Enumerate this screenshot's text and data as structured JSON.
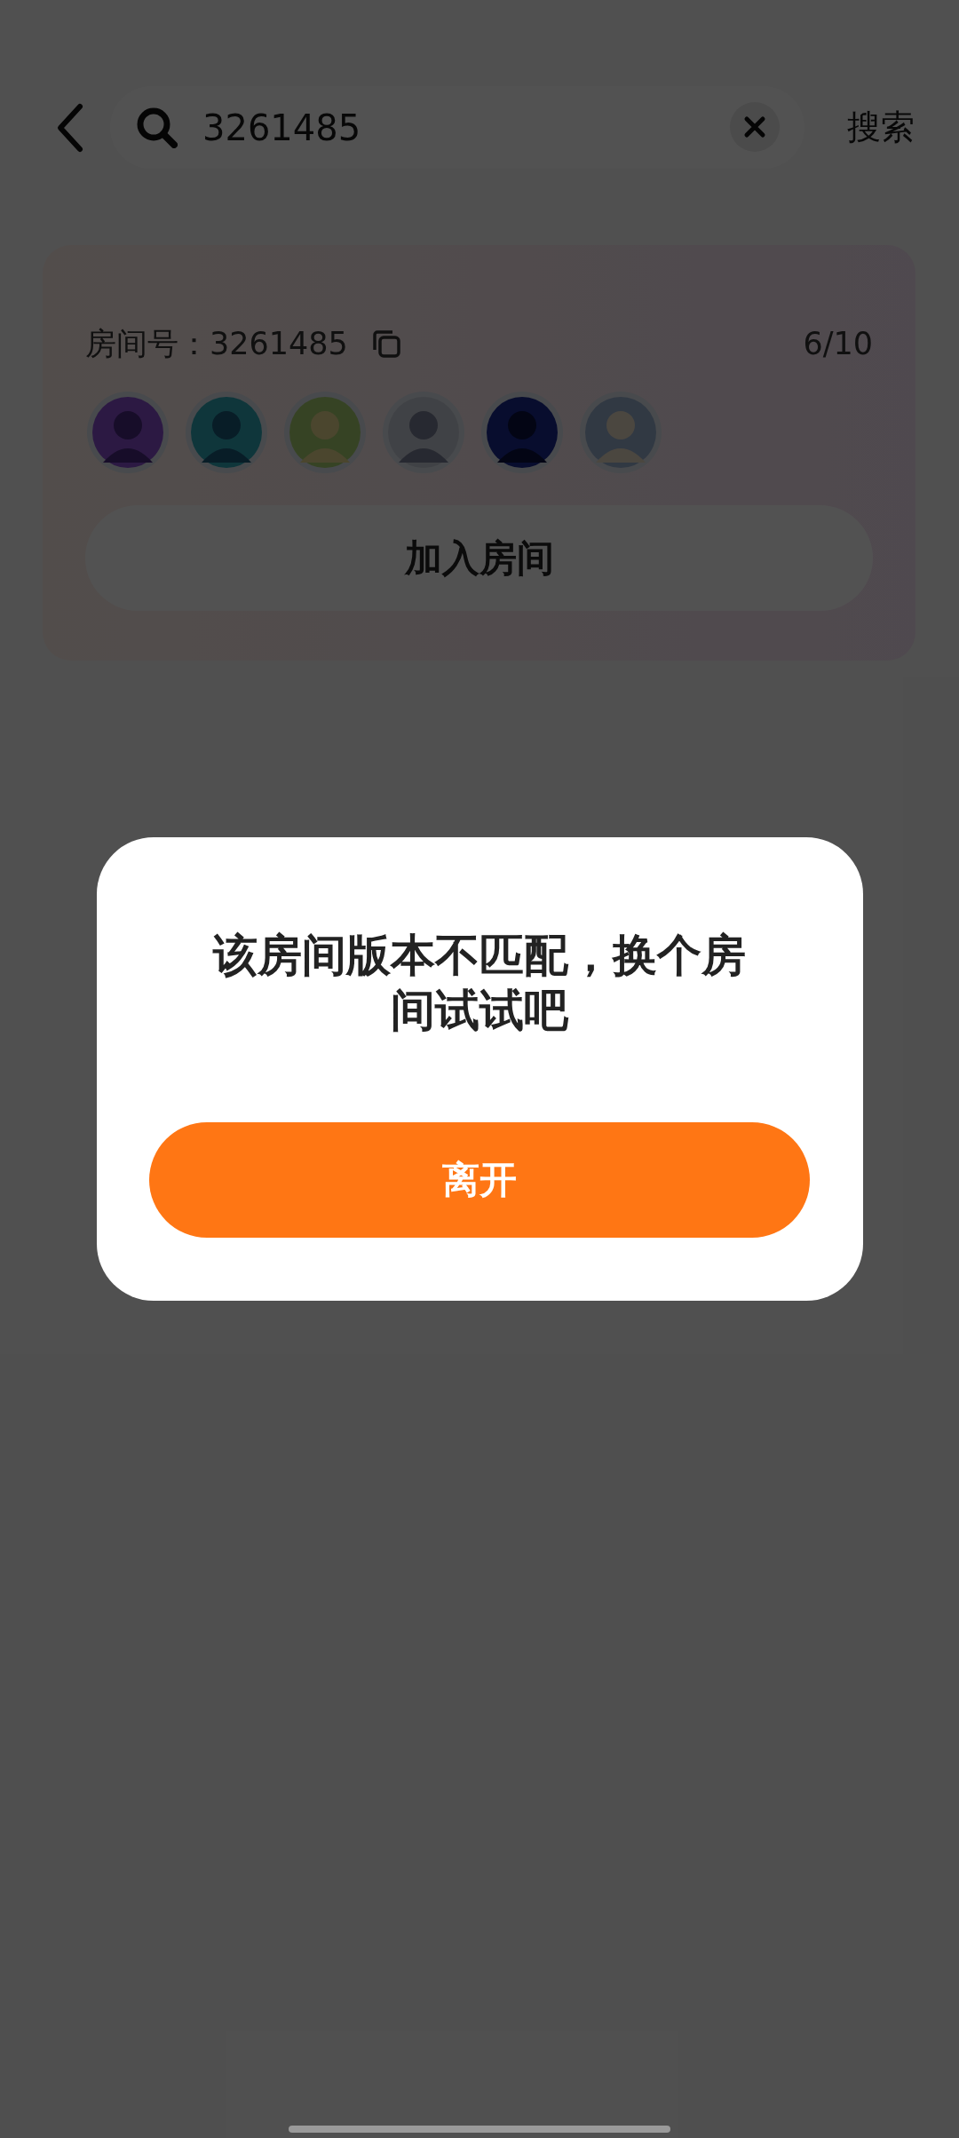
{
  "header": {
    "search": {
      "value": "3261485"
    },
    "search_button": "搜索"
  },
  "room_card": {
    "room_label": "房间号：3261485",
    "occupancy": "6/10",
    "join_button": "加入房间"
  },
  "dialog": {
    "message": "该房间版本不匹配，换个房间试试吧",
    "button": "离开"
  }
}
